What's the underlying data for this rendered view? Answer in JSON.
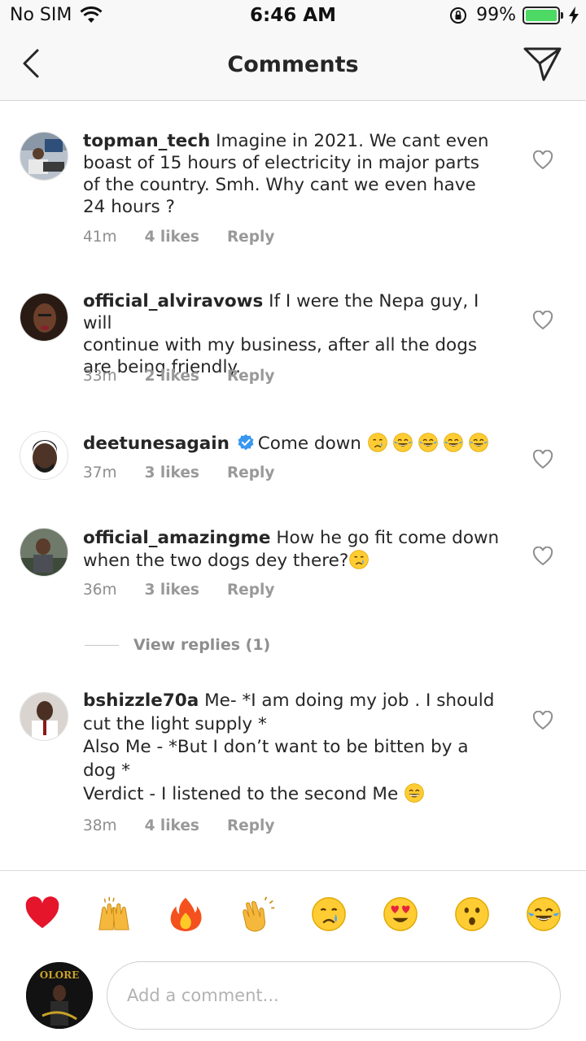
{
  "status_bar": {
    "carrier": "No SIM",
    "time": "6:46 AM",
    "battery": "99%",
    "battery_level": 0.99
  },
  "header": {
    "title": "Comments",
    "back_icon": "chevron-left-icon",
    "send_icon": "paper-plane-icon"
  },
  "comments": [
    {
      "username": "topman_tech",
      "lines": [
        " Imagine in 2021. We cant even",
        "boast of 15 hours of electricity in major parts",
        "of the country. Smh. Why cant we even have",
        "24 hours ?"
      ],
      "time": "41m",
      "likes": "4 likes",
      "reply": "Reply"
    },
    {
      "username": "official_alviravows",
      "lines": [
        " If I were the Nepa guy, I will",
        "continue with my business, after all the dogs",
        "are being friendly."
      ],
      "time": "33m",
      "likes": "2 likes",
      "reply": "Reply"
    },
    {
      "username": "deetunesagain",
      "lines": [
        "Come down "
      ],
      "verified": true,
      "emojis": [
        "crying-face",
        "tears-of-joy",
        "tears-of-joy",
        "tears-of-joy",
        "tears-of-joy"
      ],
      "time": "37m",
      "likes": "3 likes",
      "reply": "Reply"
    },
    {
      "username": "official_amazingme",
      "lines": [
        " How he go fit come down",
        "when the two dogs dey there?"
      ],
      "emojis": [
        "crying-face"
      ],
      "time": "36m",
      "likes": "3 likes",
      "reply": "Reply"
    },
    {
      "username": "bshizzle70a",
      "lines": [
        " Me- *I am doing my job . I should",
        "cut the light supply *",
        "Also Me - *But I don’t want to be bitten by a",
        "dog *",
        "Verdict - I listened to the second Me "
      ],
      "emojis": [
        "grinning-face"
      ],
      "time": "38m",
      "likes": "4 likes",
      "reply": "Reply"
    }
  ],
  "view_replies": "View replies (1)",
  "quick_reactions": [
    "red-heart",
    "raising-hands",
    "fire",
    "clapping-hands",
    "crying-face",
    "heart-eyes",
    "astonished-face",
    "tears-of-joy"
  ],
  "composer": {
    "placeholder": "Add a comment...",
    "avatar_text": "OLORE"
  }
}
